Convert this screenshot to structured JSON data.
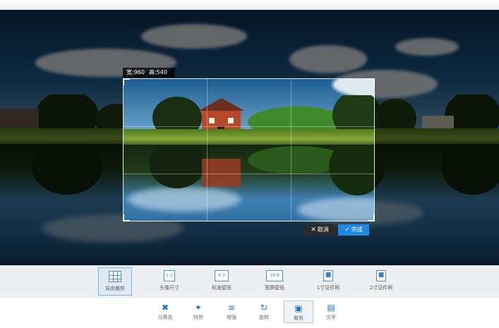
{
  "crop": {
    "width_text": "宽:960",
    "height_text": "高:540",
    "cancel_label": "取消",
    "done_label": "完成",
    "cancel_icon": "close-icon",
    "done_icon": "check-icon"
  },
  "presets": [
    {
      "label": "自由裁剪",
      "icon": "free-crop-grid-icon",
      "ratio": ""
    },
    {
      "label": "头像尺寸",
      "icon": "ratio-1-1-icon",
      "ratio": "1:1"
    },
    {
      "label": "标准壁纸",
      "icon": "ratio-4-3-icon",
      "ratio": "4:3"
    },
    {
      "label": "宽屏壁纸",
      "icon": "ratio-16-9-icon",
      "ratio": "16:9"
    },
    {
      "label": "1寸证件照",
      "icon": "id-photo-1-icon",
      "ratio": ""
    },
    {
      "label": "2寸证件照",
      "icon": "id-photo-2-icon",
      "ratio": ""
    }
  ],
  "tools": [
    {
      "label": "马赛克",
      "icon": "mosaic-icon"
    },
    {
      "label": "特效",
      "icon": "magic-wand-icon"
    },
    {
      "label": "增强",
      "icon": "sliders-icon"
    },
    {
      "label": "旋转",
      "icon": "rotate-icon"
    },
    {
      "label": "裁剪",
      "icon": "crop-icon"
    },
    {
      "label": "文字",
      "icon": "text-icon"
    }
  ],
  "colors": {
    "accent": "#1e88e5",
    "preset_active_bg": "#dfe9f5",
    "toolbar_bg": "#eceff2"
  }
}
